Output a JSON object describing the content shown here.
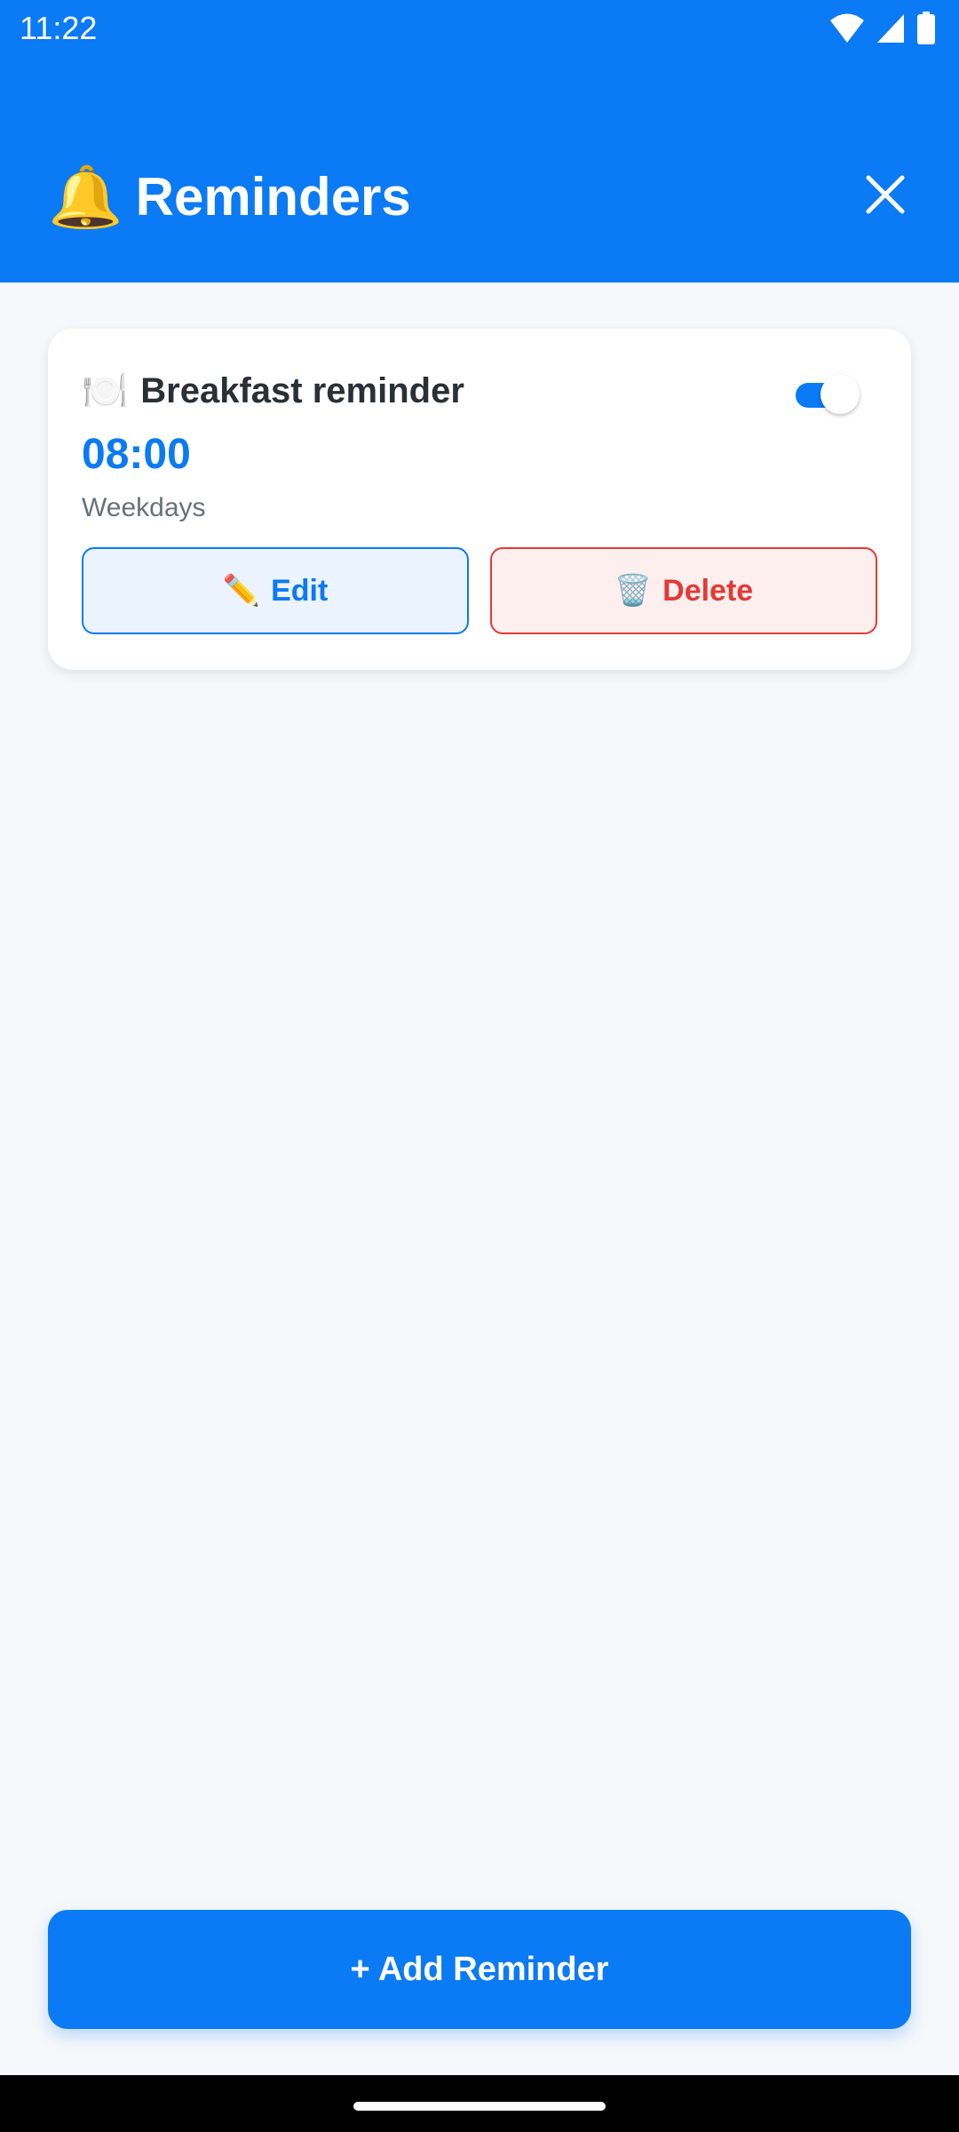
{
  "status_bar": {
    "time": "11:22",
    "icons": [
      "wifi-icon",
      "signal-icon",
      "battery-icon"
    ]
  },
  "header": {
    "icon": "🔔",
    "title": "Reminders",
    "close_icon": "close-icon"
  },
  "reminders": [
    {
      "icon": "🍽️",
      "title": "Breakfast reminder",
      "time": "08:00",
      "days": "Weekdays",
      "enabled": true,
      "edit": {
        "icon": "✏️",
        "label": "Edit"
      },
      "delete": {
        "icon": "🗑️",
        "label": "Delete"
      }
    }
  ],
  "footer": {
    "add_button_label": "+ Add Reminder"
  },
  "colors": {
    "primary": "#0A7AF5",
    "danger": "#E53935",
    "background": "#F6F8FB",
    "card": "#FFFFFF"
  }
}
